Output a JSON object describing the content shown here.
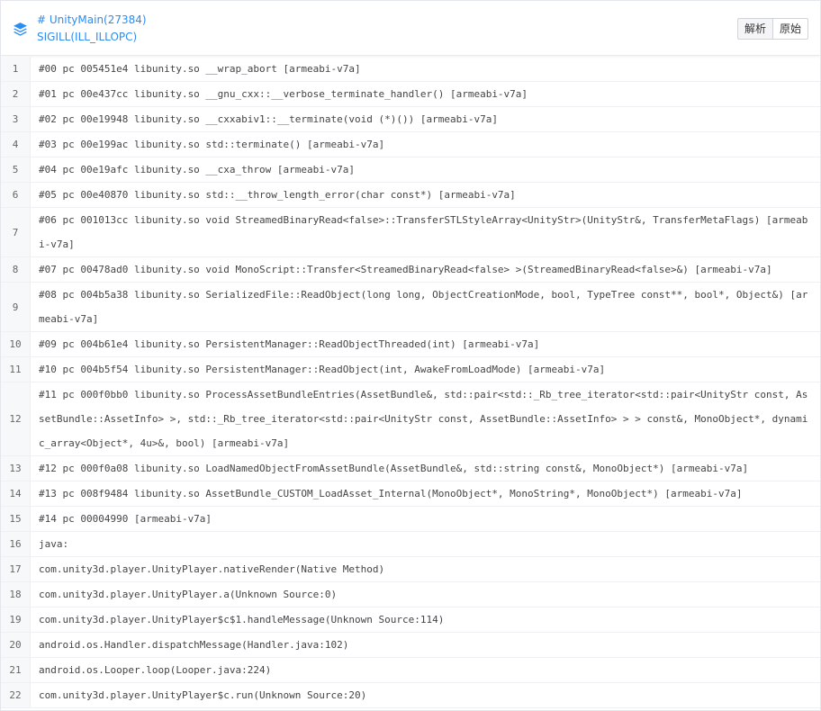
{
  "header": {
    "thread_name": "# UnityMain(27384)",
    "signal": "SIGILL(ILL_ILLOPC)",
    "icon": "layers-icon",
    "buttons": [
      "解析",
      "原始"
    ]
  },
  "colors": {
    "accent": "#2d8cf0",
    "gutter_bg": "#f7f8fa"
  },
  "lines": [
    {
      "n": "1",
      "text": "#00 pc 005451e4 libunity.so __wrap_abort [armeabi-v7a]"
    },
    {
      "n": "2",
      "text": "#01 pc 00e437cc libunity.so __gnu_cxx::__verbose_terminate_handler() [armeabi-v7a]"
    },
    {
      "n": "3",
      "text": "#02 pc 00e19948 libunity.so __cxxabiv1::__terminate(void (*)()) [armeabi-v7a]"
    },
    {
      "n": "4",
      "text": "#03 pc 00e199ac libunity.so std::terminate() [armeabi-v7a]"
    },
    {
      "n": "5",
      "text": "#04 pc 00e19afc libunity.so __cxa_throw [armeabi-v7a]"
    },
    {
      "n": "6",
      "text": "#05 pc 00e40870 libunity.so std::__throw_length_error(char const*) [armeabi-v7a]"
    },
    {
      "n": "7",
      "text": "#06 pc 001013cc libunity.so void StreamedBinaryRead<false>::TransferSTLStyleArray<UnityStr>(UnityStr&, TransferMetaFlags) [armeabi-v7a]"
    },
    {
      "n": "8",
      "text": "#07 pc 00478ad0 libunity.so void MonoScript::Transfer<StreamedBinaryRead<false> >(StreamedBinaryRead<false>&) [armeabi-v7a]"
    },
    {
      "n": "9",
      "text": "#08 pc 004b5a38 libunity.so SerializedFile::ReadObject(long long, ObjectCreationMode, bool, TypeTree const**, bool*, Object&) [armeabi-v7a]"
    },
    {
      "n": "10",
      "text": "#09 pc 004b61e4 libunity.so PersistentManager::ReadObjectThreaded(int) [armeabi-v7a]"
    },
    {
      "n": "11",
      "text": "#10 pc 004b5f54 libunity.so PersistentManager::ReadObject(int, AwakeFromLoadMode) [armeabi-v7a]"
    },
    {
      "n": "12",
      "text": "#11 pc 000f0bb0 libunity.so ProcessAssetBundleEntries(AssetBundle&, std::pair<std::_Rb_tree_iterator<std::pair<UnityStr const, AssetBundle::AssetInfo> >, std::_Rb_tree_iterator<std::pair<UnityStr const, AssetBundle::AssetInfo> > > const&, MonoObject*, dynamic_array<Object*, 4u>&, bool) [armeabi-v7a]"
    },
    {
      "n": "13",
      "text": "#12 pc 000f0a08 libunity.so LoadNamedObjectFromAssetBundle(AssetBundle&, std::string const&, MonoObject*) [armeabi-v7a]"
    },
    {
      "n": "14",
      "text": "#13 pc 008f9484 libunity.so AssetBundle_CUSTOM_LoadAsset_Internal(MonoObject*, MonoString*, MonoObject*) [armeabi-v7a]"
    },
    {
      "n": "15",
      "text": "#14 pc 00004990 [armeabi-v7a]"
    },
    {
      "n": "16",
      "text": "java:"
    },
    {
      "n": "17",
      "text": "com.unity3d.player.UnityPlayer.nativeRender(Native Method)"
    },
    {
      "n": "18",
      "text": "com.unity3d.player.UnityPlayer.a(Unknown Source:0)"
    },
    {
      "n": "19",
      "text": "com.unity3d.player.UnityPlayer$c$1.handleMessage(Unknown Source:114)"
    },
    {
      "n": "20",
      "text": "android.os.Handler.dispatchMessage(Handler.java:102)"
    },
    {
      "n": "21",
      "text": "android.os.Looper.loop(Looper.java:224)"
    },
    {
      "n": "22",
      "text": "com.unity3d.player.UnityPlayer$c.run(Unknown Source:20)"
    }
  ]
}
